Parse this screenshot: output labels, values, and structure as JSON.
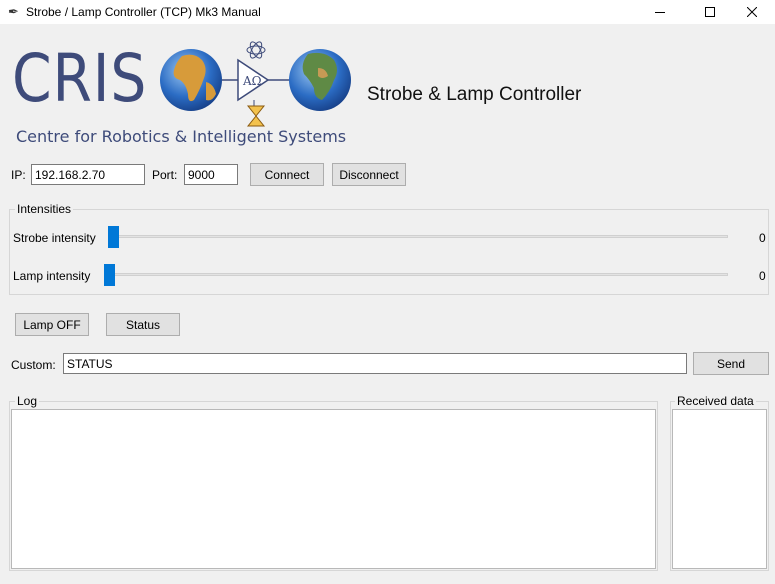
{
  "window": {
    "title": "Strobe / Lamp Controller (TCP) Mk3 Manual",
    "icon": "feather-icon"
  },
  "logo": {
    "name": "CRIS",
    "subtitle": "Centre for Robotics & Intelligent Systems",
    "colors": {
      "brand": "#3e4b7a",
      "globe_sea": "#2b6cc4",
      "globe_land": "#d79b3a"
    }
  },
  "heading": "Strobe & Lamp Controller",
  "connection": {
    "ip_label": "IP:",
    "ip_value": "192.168.2.70",
    "port_label": "Port:",
    "port_value": "9000",
    "connect_label": "Connect",
    "disconnect_label": "Disconnect"
  },
  "intensities": {
    "group_title": "Intensities",
    "strobe": {
      "label": "Strobe intensity",
      "value": "0",
      "level": 0
    },
    "lamp": {
      "label": "Lamp intensity",
      "value": "0",
      "level": 0
    },
    "accent_color": "#0078d7"
  },
  "actions": {
    "lamp_toggle_label": "Lamp OFF",
    "status_label": "Status"
  },
  "custom": {
    "label": "Custom:",
    "value": "STATUS",
    "send_label": "Send"
  },
  "log": {
    "title": "Log"
  },
  "received": {
    "title": "Received data"
  }
}
